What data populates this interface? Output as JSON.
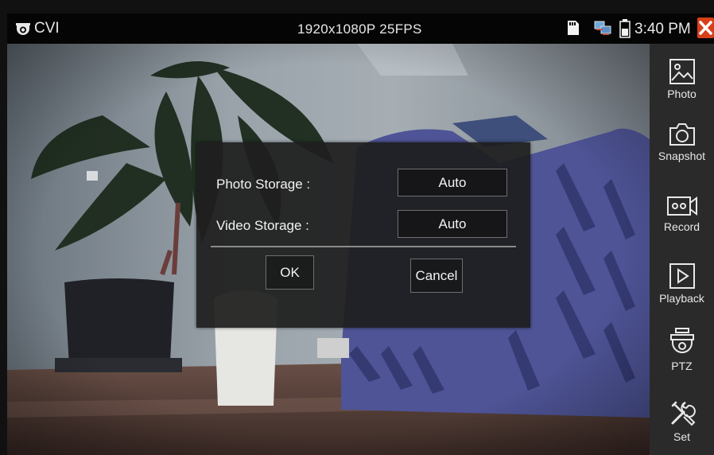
{
  "status_bar": {
    "mode_icon": "camera-dome-icon",
    "mode": "CVI",
    "resolution": "1920x1080P 25FPS",
    "sd_icon": "sd-card-icon",
    "network_icon": "network-icon",
    "battery_icon": "battery-icon",
    "time": "3:40 PM",
    "close_icon": "close-icon",
    "close_color": "#d8401a"
  },
  "toolbar": {
    "items": [
      {
        "label": "Photo",
        "icon": "photo-icon"
      },
      {
        "label": "Snapshot",
        "icon": "camera-icon"
      },
      {
        "label": "Record",
        "icon": "video-record-icon"
      },
      {
        "label": "Playback",
        "icon": "play-icon"
      },
      {
        "label": "PTZ",
        "icon": "ptz-camera-icon"
      },
      {
        "label": "Set",
        "icon": "tools-icon"
      }
    ]
  },
  "dialog": {
    "photo_storage_label": "Photo Storage :",
    "photo_storage_value": "Auto",
    "video_storage_label": "Video Storage :",
    "video_storage_value": "Auto",
    "ok_label": "OK",
    "cancel_label": "Cancel"
  }
}
